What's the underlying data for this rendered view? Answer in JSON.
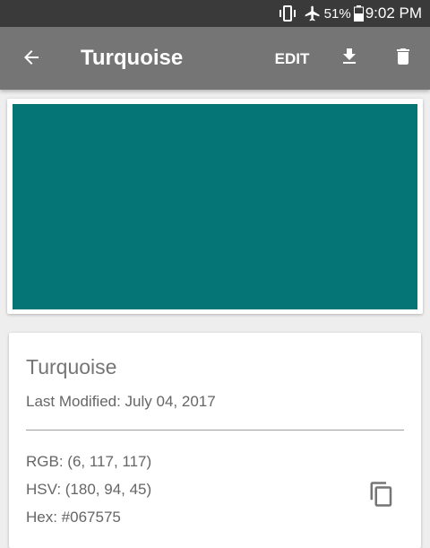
{
  "status_bar": {
    "battery_percent": "51%",
    "time": "9:02 PM",
    "icons": [
      "vibrate-icon",
      "airplane-mode-icon",
      "battery-icon"
    ]
  },
  "app_bar": {
    "title": "Turquoise",
    "edit_label": "EDIT",
    "icons": [
      "back-arrow-icon",
      "download-icon",
      "delete-icon"
    ],
    "background_color": "#757575"
  },
  "swatch": {
    "color": "#067575"
  },
  "info": {
    "name": "Turquoise",
    "last_modified": "Last Modified: July 04, 2017",
    "rgb": "RGB: (6, 117, 117)",
    "hsv": "HSV: (180, 94, 45)",
    "hex": "Hex: #067575",
    "copy_icon": "copy-icon"
  }
}
